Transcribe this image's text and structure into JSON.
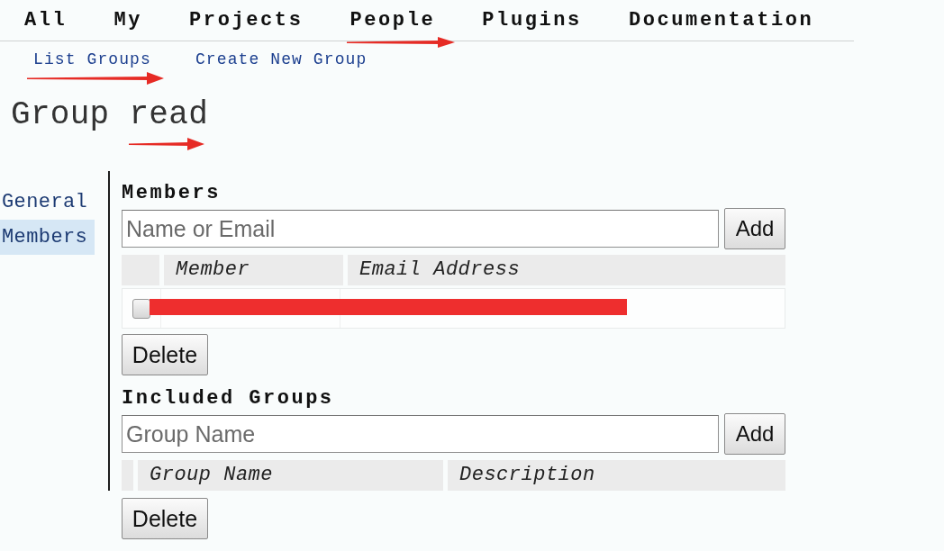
{
  "top_nav": [
    {
      "label": "All",
      "annotation_arrow": false
    },
    {
      "label": "My",
      "annotation_arrow": false
    },
    {
      "label": "Projects",
      "annotation_arrow": false
    },
    {
      "label": "People",
      "annotation_arrow": true
    },
    {
      "label": "Plugins",
      "annotation_arrow": false
    },
    {
      "label": "Documentation",
      "annotation_arrow": false
    }
  ],
  "sub_nav": [
    {
      "label": "List Groups",
      "annotation_arrow": true
    },
    {
      "label": "Create New Group",
      "annotation_arrow": false
    }
  ],
  "title": {
    "text": "Group read",
    "annotation_arrow": true
  },
  "sidebar": {
    "items": [
      {
        "label": "General",
        "selected": false
      },
      {
        "label": "Members",
        "selected": true
      }
    ]
  },
  "sections": [
    {
      "heading": "Members",
      "field": {
        "placeholder": "Name or Email"
      },
      "add_button": "Add",
      "table": {
        "columns": [
          "Member",
          "Email Address"
        ],
        "rows": [
          {
            "checked": false,
            "redacted": true
          }
        ]
      },
      "delete_button": "Delete"
    },
    {
      "heading": "Included Groups",
      "field": {
        "placeholder": "Group Name"
      },
      "add_button": "Add",
      "table": {
        "columns": [
          "Group Name",
          "Description"
        ]
      },
      "delete_button": "Delete"
    }
  ]
}
